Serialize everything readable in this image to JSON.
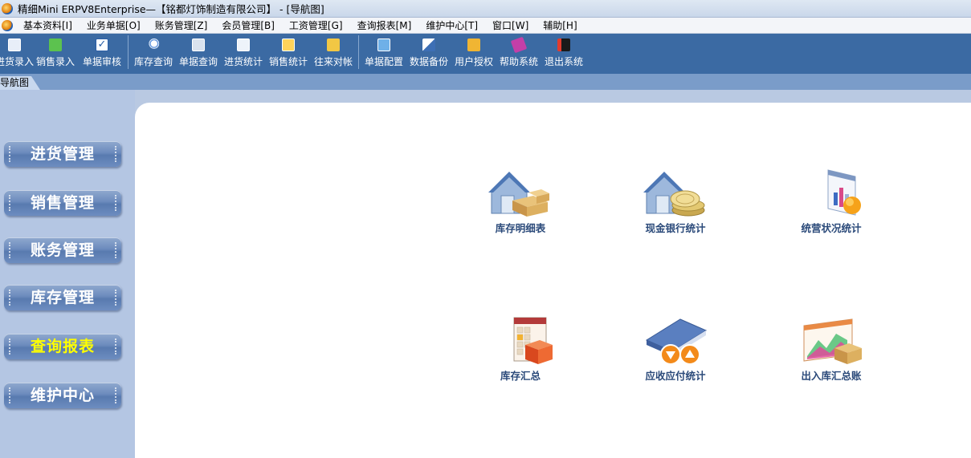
{
  "window": {
    "title": "精细Mini ERPV8Enterprise—【铭都灯饰制造有限公司】 - [导航图]"
  },
  "menu": [
    "基本资料[I]",
    "业务单据[O]",
    "账务管理[Z]",
    "会员管理[B]",
    "工资管理[G]",
    "查询报表[M]",
    "维护中心[T]",
    "窗口[W]",
    "辅助[H]"
  ],
  "toolbar": {
    "group1": [
      "进货录入",
      "销售录入",
      "单据审核"
    ],
    "group2": [
      "库存查询",
      "单据查询",
      "进货统计",
      "销售统计",
      "往来对帐"
    ],
    "group3": [
      "单据配置",
      "数据备份",
      "用户授权",
      "帮助系统",
      "退出系统"
    ]
  },
  "tab": {
    "label": "导航图"
  },
  "nav": [
    {
      "label": "进货管理",
      "active": false
    },
    {
      "label": "销售管理",
      "active": false
    },
    {
      "label": "账务管理",
      "active": false
    },
    {
      "label": "库存管理",
      "active": false
    },
    {
      "label": "查询报表",
      "active": true
    },
    {
      "label": "维护中心",
      "active": false
    }
  ],
  "tiles": [
    {
      "label": "库存明细表",
      "icon": "warehouse-boxes-icon"
    },
    {
      "label": "现金银行统计",
      "icon": "warehouse-coins-icon"
    },
    {
      "label": "统营状况统计",
      "icon": "chart-orb-icon"
    },
    {
      "label": "库存汇总",
      "icon": "calendar-box-icon"
    },
    {
      "label": "应收应付统计",
      "icon": "book-arrows-icon"
    },
    {
      "label": "出入库汇总账",
      "icon": "chart-boxes-icon"
    }
  ]
}
